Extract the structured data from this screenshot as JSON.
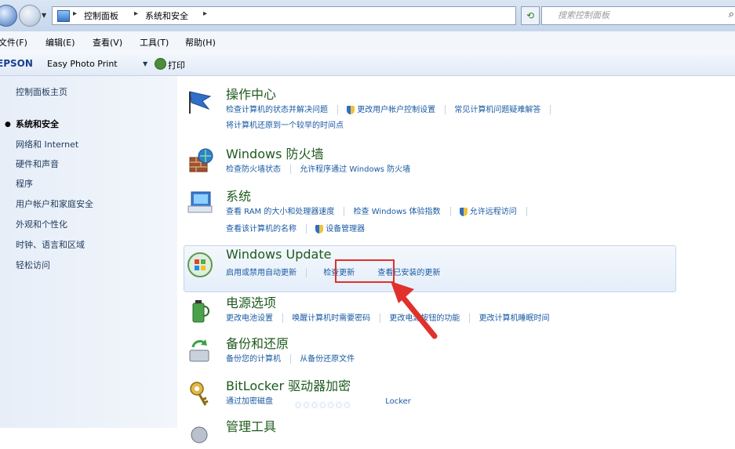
{
  "address_bar": {
    "crumbs": [
      "控制面板",
      "系统和安全"
    ],
    "search_placeholder": "搜索控制面板"
  },
  "menu": [
    "文件(F)",
    "编辑(E)",
    "查看(V)",
    "工具(T)",
    "帮助(H)"
  ],
  "toolbar": {
    "brand": "EPSON",
    "app": "Easy Photo Print",
    "print": "打印"
  },
  "sidebar": {
    "home": "控制面板主页",
    "current": "系统和安全",
    "items": [
      "网络和 Internet",
      "硬件和声音",
      "程序",
      "用户帐户和家庭安全",
      "外观和个性化",
      "时钟、语言和区域",
      "轻松访问"
    ]
  },
  "categories": {
    "action_center": {
      "title": "操作中心",
      "links": [
        "检查计算机的状态并解决问题",
        "更改用户帐户控制设置",
        "常见计算机问题疑难解答",
        "将计算机还原到一个较早的时间点"
      ]
    },
    "firewall": {
      "title": "Windows 防火墙",
      "links": [
        "检查防火墙状态",
        "允许程序通过 Windows 防火墙"
      ]
    },
    "system": {
      "title": "系统",
      "links": [
        "查看 RAM 的大小和处理器速度",
        "检查 Windows 体验指数",
        "允许远程访问",
        "查看该计算机的名称",
        "设备管理器"
      ]
    },
    "windows_update": {
      "title": "Windows Update",
      "links": [
        "启用或禁用自动更新",
        "检查更新",
        "查看已安装的更新"
      ]
    },
    "power": {
      "title": "电源选项",
      "links": [
        "更改电池设置",
        "唤醒计算机时需要密码",
        "更改电源按钮的功能",
        "更改计算机睡眠时间"
      ]
    },
    "backup": {
      "title": "备份和还原",
      "links": [
        "备份您的计算机",
        "从备份还原文件"
      ]
    },
    "bitlocker": {
      "title": "BitLocker 驱动器加密",
      "links": [
        "通过加密磁盘",
        "Locker"
      ]
    },
    "admin_tools": {
      "title": "管理工具"
    }
  },
  "colors": {
    "highlight": "#e0312c",
    "link": "#1a5aa3",
    "title": "#1e5a1e"
  }
}
